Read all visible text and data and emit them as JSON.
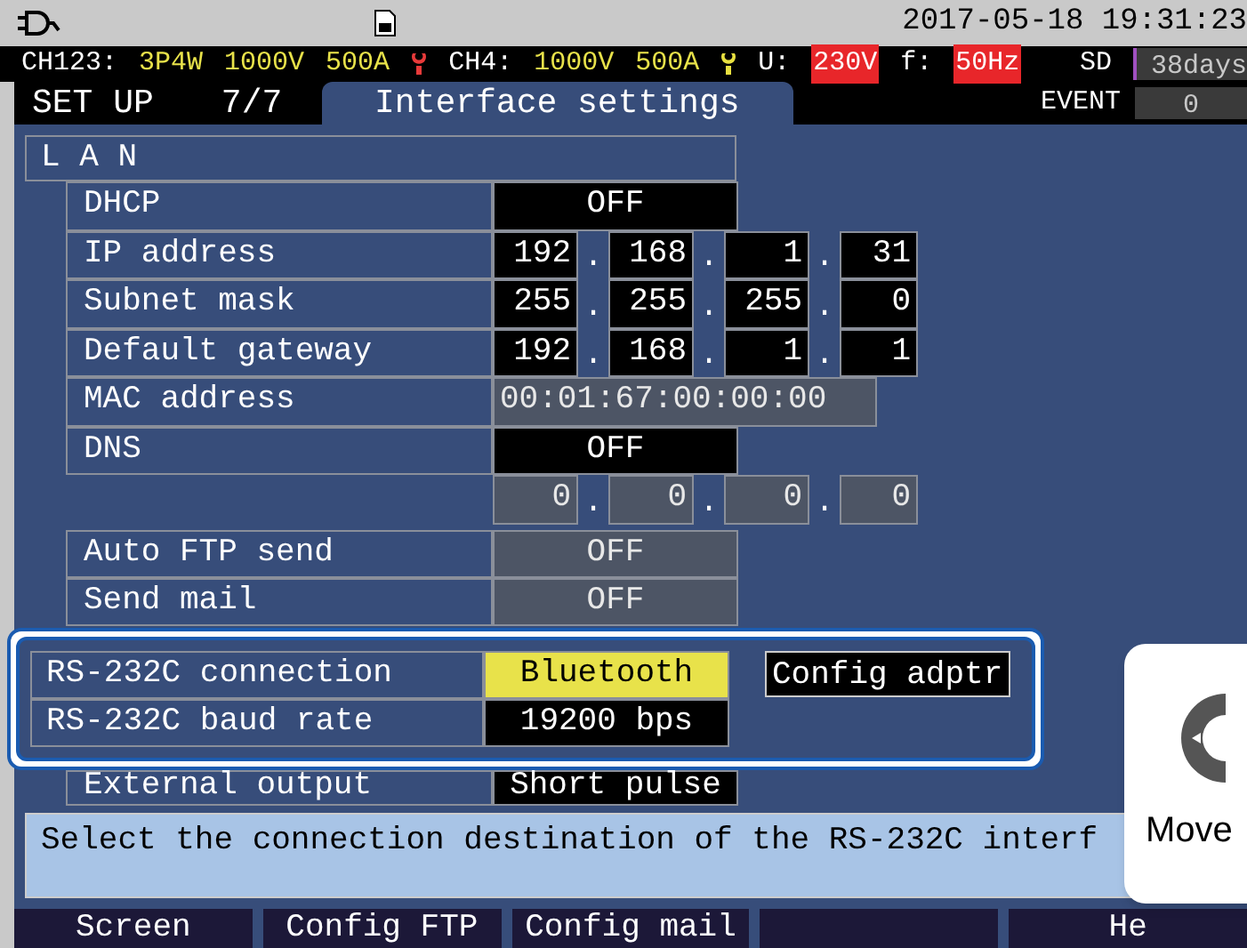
{
  "top_bar": {
    "date_time": "2017-05-18 19:31:23"
  },
  "status_bar": {
    "items": [
      {
        "kind": "label",
        "text": "CH123:"
      },
      {
        "kind": "value",
        "text": "3P4W"
      },
      {
        "kind": "value",
        "text": "1000V"
      },
      {
        "kind": "value",
        "text": "500A"
      },
      {
        "kind": "clamp",
        "color": "#e83a3a"
      },
      {
        "kind": "label",
        "text": "CH4:"
      },
      {
        "kind": "value",
        "text": "1000V"
      },
      {
        "kind": "value",
        "text": "500A"
      },
      {
        "kind": "clamp",
        "color": "#e8e040"
      },
      {
        "kind": "label",
        "text": "U:"
      },
      {
        "kind": "alert",
        "text": "230V"
      },
      {
        "kind": "label",
        "text": "f:"
      },
      {
        "kind": "alert",
        "text": "50Hz"
      }
    ],
    "storage": {
      "label": "SD",
      "remaining": "38days"
    }
  },
  "header": {
    "title": "SET UP",
    "page": "7/7",
    "tab": "Interface settings",
    "event_label": "EVENT",
    "event_count": "0"
  },
  "lan": {
    "title": "L A N",
    "separator": ".",
    "rows": [
      {
        "label": "DHCP",
        "kind": "single",
        "values": [
          {
            "text": "OFF",
            "selected": false,
            "disabled": false
          }
        ]
      },
      {
        "label": "IP address",
        "kind": "ip",
        "values": [
          {
            "text": "192",
            "selected": false,
            "disabled": false
          },
          {
            "text": "168",
            "selected": false,
            "disabled": false
          },
          {
            "text": "1",
            "selected": false,
            "disabled": false
          },
          {
            "text": "31",
            "selected": false,
            "disabled": false
          }
        ]
      },
      {
        "label": "Subnet mask",
        "kind": "ip",
        "values": [
          {
            "text": "255",
            "selected": false,
            "disabled": false
          },
          {
            "text": "255",
            "selected": false,
            "disabled": false
          },
          {
            "text": "255",
            "selected": false,
            "disabled": false
          },
          {
            "text": "0",
            "selected": false,
            "disabled": false
          }
        ]
      },
      {
        "label": "Default gateway",
        "kind": "ip",
        "values": [
          {
            "text": "192",
            "selected": false,
            "disabled": false
          },
          {
            "text": "168",
            "selected": false,
            "disabled": false
          },
          {
            "text": "1",
            "selected": false,
            "disabled": false
          },
          {
            "text": "1",
            "selected": false,
            "disabled": false
          }
        ]
      },
      {
        "label": "MAC address",
        "kind": "wide",
        "values": [
          {
            "text": "00:01:67:00:00:00",
            "selected": false,
            "disabled": true
          }
        ]
      },
      {
        "label": "DNS",
        "kind": "single",
        "values": [
          {
            "text": "OFF",
            "selected": false,
            "disabled": false
          }
        ]
      },
      {
        "kind": "ip",
        "values": [
          {
            "text": "0",
            "selected": false,
            "disabled": true
          },
          {
            "text": "0",
            "selected": false,
            "disabled": true
          },
          {
            "text": "0",
            "selected": false,
            "disabled": true
          },
          {
            "text": "0",
            "selected": false,
            "disabled": true
          }
        ]
      }
    ]
  },
  "send": [
    {
      "label": "Auto FTP send",
      "value": {
        "text": "OFF",
        "selected": false,
        "disabled": true
      }
    },
    {
      "label": "Send mail",
      "value": {
        "text": "OFF",
        "selected": false,
        "disabled": true
      }
    }
  ],
  "rs232c": {
    "rows": [
      {
        "label": "RS-232C connection",
        "value": {
          "text": "Bluetooth",
          "selected": true,
          "disabled": false
        }
      },
      {
        "label": "RS-232C baud rate",
        "value": {
          "text": "19200 bps",
          "selected": false,
          "disabled": false
        }
      }
    ],
    "button": "Config adptr"
  },
  "external_output": {
    "label": "External output",
    "value": {
      "text": "Short pulse",
      "selected": false,
      "disabled": false
    }
  },
  "message": "Select the connection destination of the RS-232C interf",
  "function_keys": [
    {
      "kind": "key",
      "label": "Screen"
    },
    {
      "kind": "key",
      "label": "Config FTP"
    },
    {
      "kind": "key",
      "label": "Config mail"
    },
    {
      "kind": "blank"
    },
    {
      "kind": "key",
      "label": "He"
    }
  ],
  "move_popup": {
    "label": "Move"
  }
}
